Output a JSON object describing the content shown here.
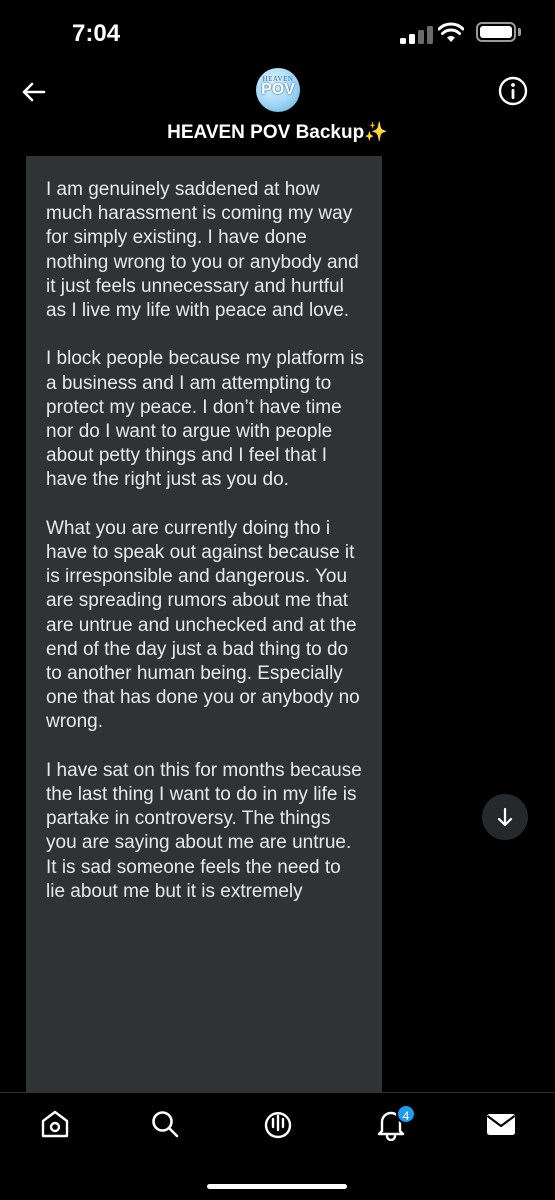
{
  "status_bar": {
    "time": "7:04",
    "signal_bars": 4,
    "signal_bars_active": 2,
    "battery_level": 1.0
  },
  "header": {
    "title": "HEAVEN POV Backup",
    "title_emoji": "✨",
    "avatar_top_text": "HEAVEN",
    "avatar_main_text": "POV",
    "back_icon": "arrow-left-icon",
    "info_icon": "info-icon"
  },
  "message": {
    "paragraphs": [
      "I am genuinely saddened at how much harassment is coming my way for simply existing. I have done nothing wrong to you or anybody and it just feels unnecessary and hurtful as I live my life with peace and love.",
      "I block people because my platform is a business and I am attempting to protect my peace. I don’t have time nor do I want to argue with people about petty things and I feel that I have the right just as you do.",
      "What you are currently doing tho i have to speak out against because it is irresponsible and dangerous. You are spreading rumors about me that are untrue and unchecked and at the end of the day just a bad thing to do to another human being. Especially one that has done you or anybody no wrong.",
      "I have sat on this for months because the last thing I want to do in my life is partake in controversy. The things you are saying about me are untrue. It is sad someone feels the need to lie about me but it is extremely"
    ]
  },
  "bottom_nav": {
    "items": [
      "home-icon",
      "search-icon",
      "spaces-icon",
      "notifications-icon",
      "messages-icon"
    ],
    "notifications_badge": "4"
  },
  "colors": {
    "background": "#000000",
    "bubble": "#2f3336",
    "text": "#e7e9ea",
    "accent": "#1d9bf0"
  }
}
